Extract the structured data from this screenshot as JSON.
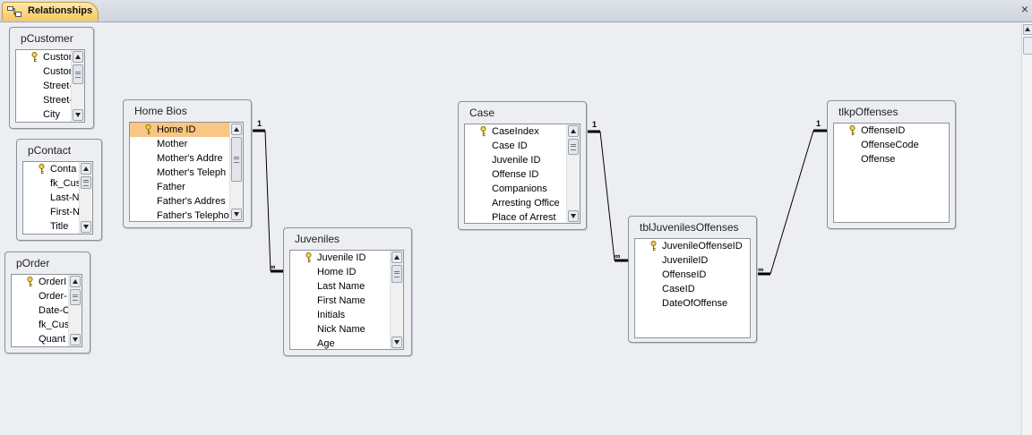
{
  "window": {
    "tab_label": "Relationships",
    "tab_icon": "relationships-icon",
    "close_label": "×"
  },
  "tables": {
    "pCustomer": {
      "title": "pCustomer",
      "fields": [
        "Custom",
        "Custom",
        "Street-",
        "Street-",
        "City"
      ],
      "key_rows": [
        0
      ],
      "selected_row": null
    },
    "pContact": {
      "title": "pContact",
      "fields": [
        "Conta",
        "fk_Cus",
        "Last-N",
        "First-N",
        "Title"
      ],
      "key_rows": [
        0
      ],
      "selected_row": null
    },
    "pOrder": {
      "title": "pOrder",
      "fields": [
        "OrderI",
        "Order-",
        "Date-C",
        "fk_Cus",
        "Quant"
      ],
      "key_rows": [
        0
      ],
      "selected_row": null
    },
    "homeBios": {
      "title": "Home Bios",
      "fields": [
        "Home ID",
        "Mother",
        "Mother's Addre",
        "Mother's Teleph",
        "Father",
        "Father's Addres",
        "Father's Telepho"
      ],
      "key_rows": [
        0
      ],
      "selected_row": 0
    },
    "juveniles": {
      "title": "Juveniles",
      "fields": [
        "Juvenile ID",
        "Home ID",
        "Last Name",
        "First Name",
        "Initials",
        "Nick Name",
        "Age"
      ],
      "key_rows": [
        0
      ],
      "selected_row": null
    },
    "case": {
      "title": "Case",
      "fields": [
        "CaseIndex",
        "Case ID",
        "Juvenile ID",
        "Offense ID",
        "Companions",
        "Arresting Office",
        "Place of Arrest"
      ],
      "key_rows": [
        0
      ],
      "selected_row": null
    },
    "tblJuvenilesOffenses": {
      "title": "tblJuvenilesOffenses",
      "fields": [
        "JuvenileOffenseID",
        "JuvenileID",
        "OffenseID",
        "CaseID",
        "DateOfOffense"
      ],
      "key_rows": [
        0
      ],
      "selected_row": null
    },
    "tlkpOffenses": {
      "title": "tlkpOffenses",
      "fields": [
        "OffenseID",
        "OffenseCode",
        "Offense"
      ],
      "key_rows": [
        0
      ],
      "selected_row": null
    }
  },
  "relationships": [
    {
      "from": "Home Bios",
      "to": "Juveniles",
      "one_label": "1",
      "many_label": "∞"
    },
    {
      "from": "Case",
      "to": "tblJuvenilesOffenses",
      "one_label": "1",
      "many_label": "∞"
    },
    {
      "from": "tlkpOffenses",
      "to": "tblJuvenilesOffenses",
      "one_label": "1",
      "many_label": "∞"
    }
  ],
  "colors": {
    "selected_row": "#f9c683",
    "tab_active": "#f7c75c",
    "key_icon": "#c9a227"
  }
}
